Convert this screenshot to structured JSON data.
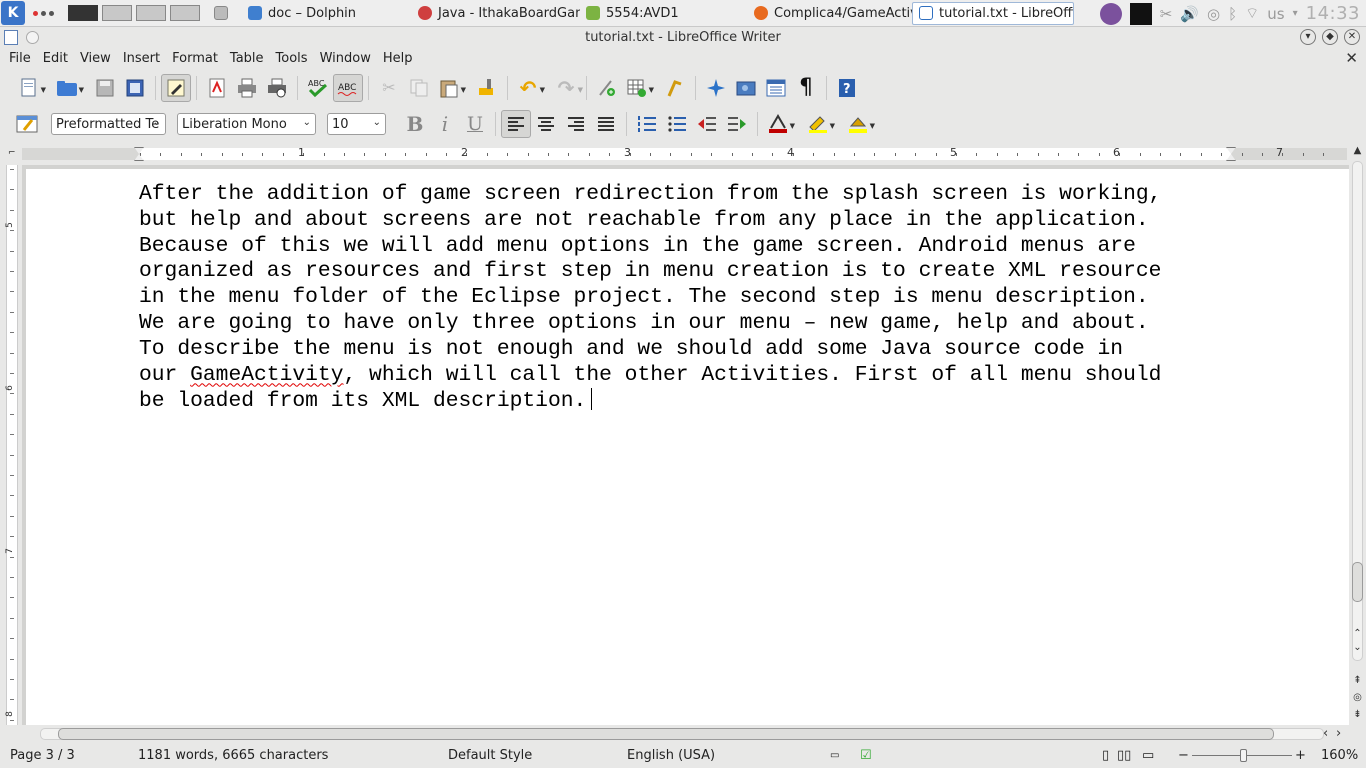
{
  "taskbar": {
    "tasks": [
      {
        "label": "doc – Dolphin",
        "color": "#3f7fcf"
      },
      {
        "label": "Java - IthakaBoardGam",
        "color": "#cf3f3f"
      },
      {
        "label": "5554:AVD1",
        "color": "#7cb342"
      },
      {
        "label": "Complica4/GameActivi",
        "color": "#e86a1f"
      },
      {
        "label": "tutorial.txt - LibreOffic",
        "color": "#2f6fc0"
      }
    ],
    "keyboard_layout": "us",
    "clock": "14:33"
  },
  "window": {
    "title": "tutorial.txt - LibreOffice Writer"
  },
  "menubar": {
    "items": [
      "File",
      "Edit",
      "View",
      "Insert",
      "Format",
      "Table",
      "Tools",
      "Window",
      "Help"
    ]
  },
  "formatting": {
    "paragraph_style": "Preformatted Te",
    "font_name": "Liberation Mono",
    "font_size": "10"
  },
  "ruler": {
    "labels": [
      "1",
      "2",
      "3",
      "4",
      "5",
      "6",
      "7"
    ],
    "vertical_labels": [
      "5",
      "6",
      "7",
      "8"
    ]
  },
  "document": {
    "lines": [
      "After the addition of game screen redirection from the splash screen is working,",
      "but help and about screens are not reachable from any place in the application.",
      "Because of this we will add menu options in the game screen. Android menus are",
      "organized as resources and first step in menu creation is to create XML resource",
      "in the menu folder of the Eclipse project. The second step is menu description.",
      "We are going to have only three options in our menu – new game, help and about.",
      "To describe the menu is not enough and we should add some Java source code in"
    ],
    "line8_prefix": "our ",
    "line8_misspelled": "GameActivity",
    "line8_suffix": ", which will call the other Activities. First of all menu should",
    "last_line": "be loaded from its XML description."
  },
  "statusbar": {
    "page": "Page 3 / 3",
    "word_count": "1181 words, 6665 characters",
    "page_style": "Default Style",
    "language": "English (USA)",
    "zoom": "160%",
    "zoom_level_percent": 160
  }
}
